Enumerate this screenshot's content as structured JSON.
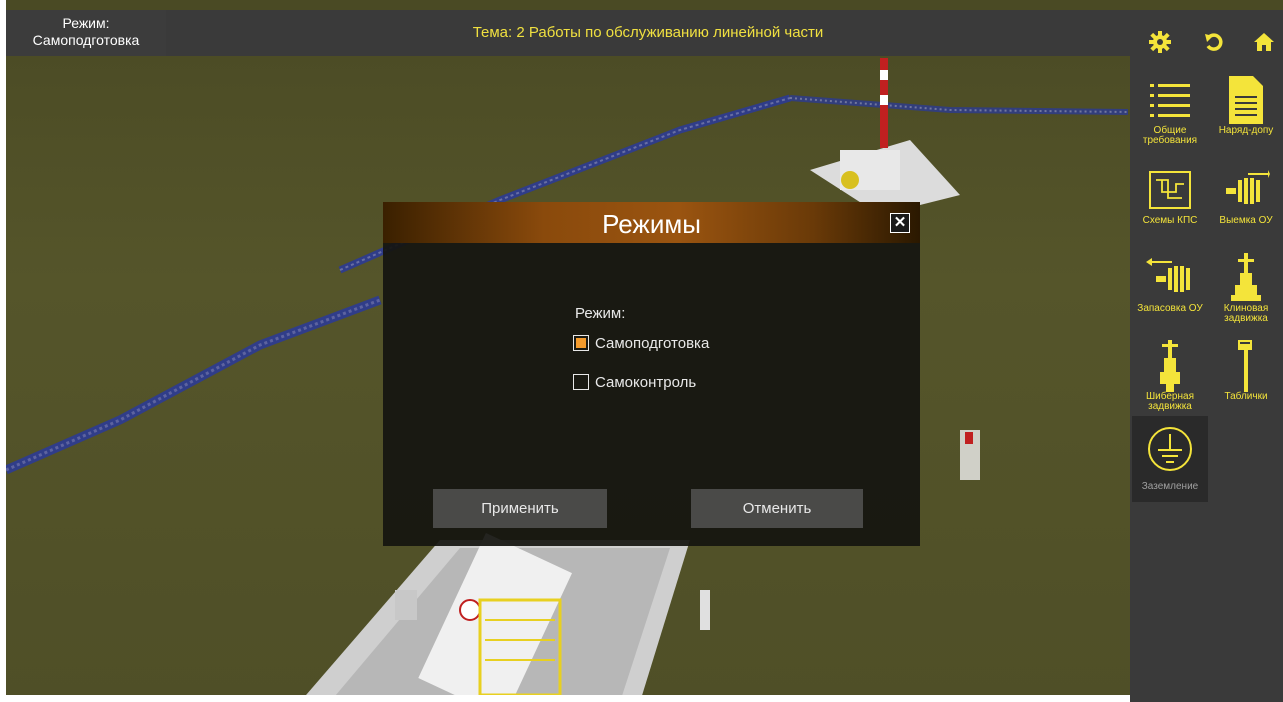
{
  "mode_box": {
    "line1": "Режим:",
    "line2": "Самоподготовка"
  },
  "topbar": {
    "title": "Тема: 2 Работы по обслуживанию линейной части"
  },
  "top_icons": [
    {
      "icon": "gear-icon"
    },
    {
      "icon": "undo-icon"
    },
    {
      "icon": "home-icon"
    }
  ],
  "sidebar": {
    "tools": [
      {
        "label": "Общие требования",
        "icon": "list-icon"
      },
      {
        "label": "Наряд-допу",
        "icon": "document-icon"
      },
      {
        "label": "Схемы КПС",
        "icon": "scheme-icon"
      },
      {
        "label": "Выемка ОУ",
        "icon": "extract-device-icon"
      },
      {
        "label": "Запасовка ОУ",
        "icon": "insert-device-icon"
      },
      {
        "label": "Клиновая задвижка",
        "icon": "wedge-valve-icon"
      },
      {
        "label": "Шиберная задвижка",
        "icon": "gate-valve-icon"
      },
      {
        "label": "Таблички",
        "icon": "sign-icon"
      },
      {
        "label": "Заземление",
        "icon": "ground-icon"
      }
    ]
  },
  "dialog": {
    "title": "Режимы",
    "mode_label": "Режим:",
    "options": [
      {
        "label": "Самоподготовка",
        "checked": true
      },
      {
        "label": "Самоконтроль",
        "checked": false
      }
    ],
    "apply_label": "Применить",
    "cancel_label": "Отменить",
    "accent_color": "#f39a2c"
  },
  "colors": {
    "accent_yellow": "#f4e43a",
    "panel": "#3a3a3a"
  }
}
